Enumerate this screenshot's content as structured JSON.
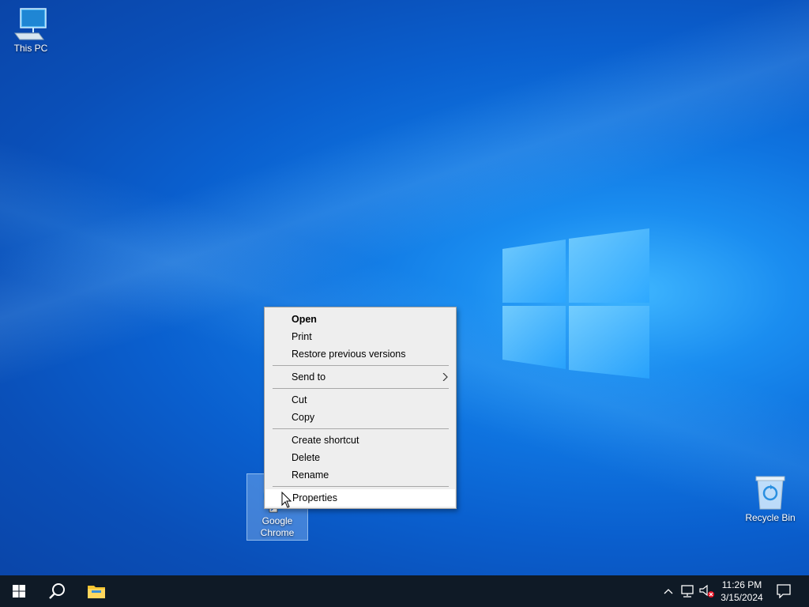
{
  "desktop": {
    "icons": [
      {
        "label": "This PC",
        "icon": "computer-icon"
      },
      {
        "label_line1": "Google",
        "label_line2": "Chrome",
        "icon": "chrome-shortcut-icon"
      },
      {
        "label": "Recycle Bin",
        "icon": "recycle-bin-icon"
      }
    ]
  },
  "context_menu": {
    "items": [
      {
        "label": "Open"
      },
      {
        "label": "Print"
      },
      {
        "label": "Restore previous versions"
      },
      {
        "label": "Send to"
      },
      {
        "label": "Cut"
      },
      {
        "label": "Copy"
      },
      {
        "label": "Create shortcut"
      },
      {
        "label": "Delete"
      },
      {
        "label": "Rename"
      },
      {
        "label": "Properties"
      }
    ]
  },
  "taskbar": {
    "start_icon": "windows-start-icon",
    "search_icon": "search-icon",
    "explorer_icon": "file-explorer-icon",
    "tray": {
      "chevron_icon": "chevron-up-icon",
      "network_icon": "network-icon",
      "volume_icon": "volume-muted-icon",
      "notification_icon": "notification-icon"
    },
    "clock": {
      "time": "11:26 PM",
      "date": "3/15/2024"
    }
  },
  "colors": {
    "taskbar_bg": "#0f1a26",
    "menu_bg": "#eeeeee",
    "desktop_accent": "#1a8df0"
  }
}
